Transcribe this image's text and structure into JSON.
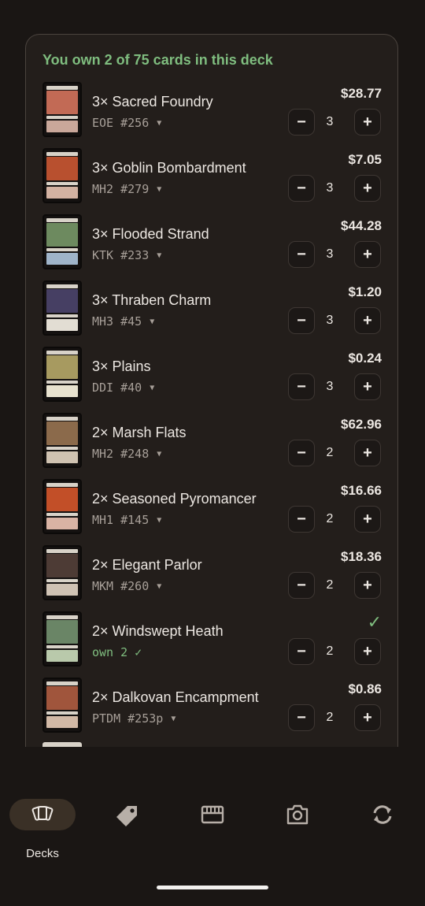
{
  "deck": {
    "summary": "You own 2 of 75 cards in this deck",
    "cards": [
      {
        "name": "3× Sacred Foundry",
        "set": "EOE #256",
        "price": "$28.77",
        "qty": "3",
        "owned": false,
        "art": "#c26a55",
        "box": "#c9a79a"
      },
      {
        "name": "3× Goblin Bombardment",
        "set": "MH2 #279",
        "price": "$7.05",
        "qty": "3",
        "owned": false,
        "art": "#b8502f",
        "box": "#d3b2a2"
      },
      {
        "name": "3× Flooded Strand",
        "set": "KTK #233",
        "price": "$44.28",
        "qty": "3",
        "owned": false,
        "art": "#6d8a5f",
        "box": "#9fb4c9"
      },
      {
        "name": "3× Thraben Charm",
        "set": "MH3 #45",
        "price": "$1.20",
        "qty": "3",
        "owned": false,
        "art": "#463f63",
        "box": "#e2ddd3"
      },
      {
        "name": "3× Plains",
        "set": "DDI #40",
        "price": "$0.24",
        "qty": "3",
        "owned": false,
        "art": "#a79a60",
        "box": "#e8e2cf"
      },
      {
        "name": "2× Marsh Flats",
        "set": "MH2 #248",
        "price": "$62.96",
        "qty": "2",
        "owned": false,
        "art": "#8b6a4b",
        "box": "#cfc2b1"
      },
      {
        "name": "2× Seasoned Pyromancer",
        "set": "MH1 #145",
        "price": "$16.66",
        "qty": "2",
        "owned": false,
        "art": "#c24f28",
        "box": "#d9b3a4"
      },
      {
        "name": "2× Elegant Parlor",
        "set": "MKM #260",
        "price": "$18.36",
        "qty": "2",
        "owned": false,
        "art": "#4d3b35",
        "box": "#cfc2b4"
      },
      {
        "name": "2× Windswept Heath",
        "set": "own 2 ✓",
        "price": "✓",
        "qty": "2",
        "owned": true,
        "art": "#6a8566",
        "box": "#b9c9ab"
      },
      {
        "name": "2× Dalkovan Encampment",
        "set": "PTDM #253p",
        "price": "$0.86",
        "qty": "2",
        "owned": false,
        "art": "#a0553c",
        "box": "#d2b9a6"
      }
    ]
  },
  "controls": {
    "minus": "−",
    "plus": "+"
  },
  "nav": {
    "items": [
      {
        "label": "Decks",
        "icon": "decks-icon",
        "active": true
      },
      {
        "label": "",
        "icon": "price-tag-icon",
        "active": false
      },
      {
        "label": "",
        "icon": "card-box-icon",
        "active": false
      },
      {
        "label": "",
        "icon": "camera-icon",
        "active": false
      },
      {
        "label": "",
        "icon": "sync-icon",
        "active": false
      }
    ]
  },
  "colors": {
    "accent_green": "#7fbd7f",
    "background": "#1a1614",
    "panel": "#231e1b",
    "active_pill": "#3a3026"
  }
}
